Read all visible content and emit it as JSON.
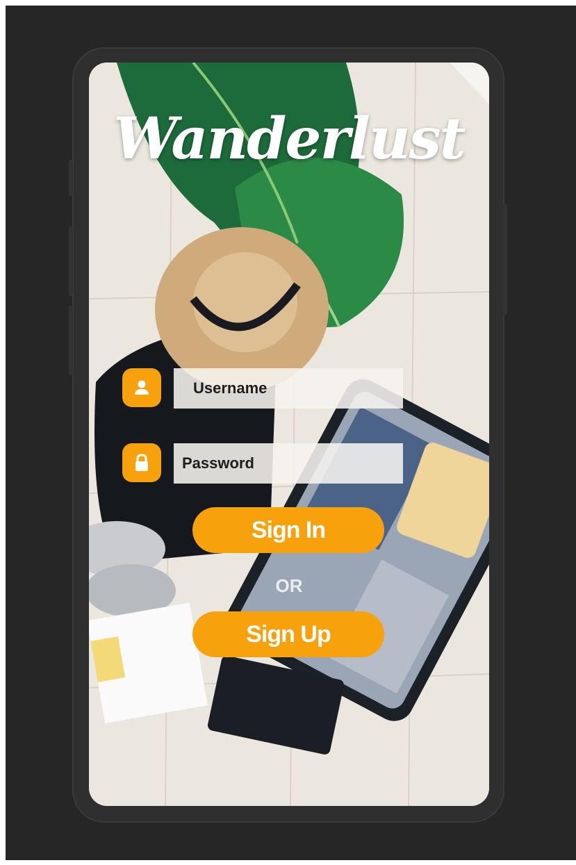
{
  "app": {
    "title": "Wanderlust"
  },
  "login": {
    "username_placeholder": "Username",
    "password_placeholder": "Password",
    "sign_in_label": "Sign In",
    "divider_label": "OR",
    "sign_up_label": "Sign Up"
  },
  "icons": {
    "username": "user-icon",
    "password": "lock-icon"
  },
  "colors": {
    "accent": "#f7a20c",
    "frame": "#262626",
    "text_on_accent": "#ffffff"
  }
}
